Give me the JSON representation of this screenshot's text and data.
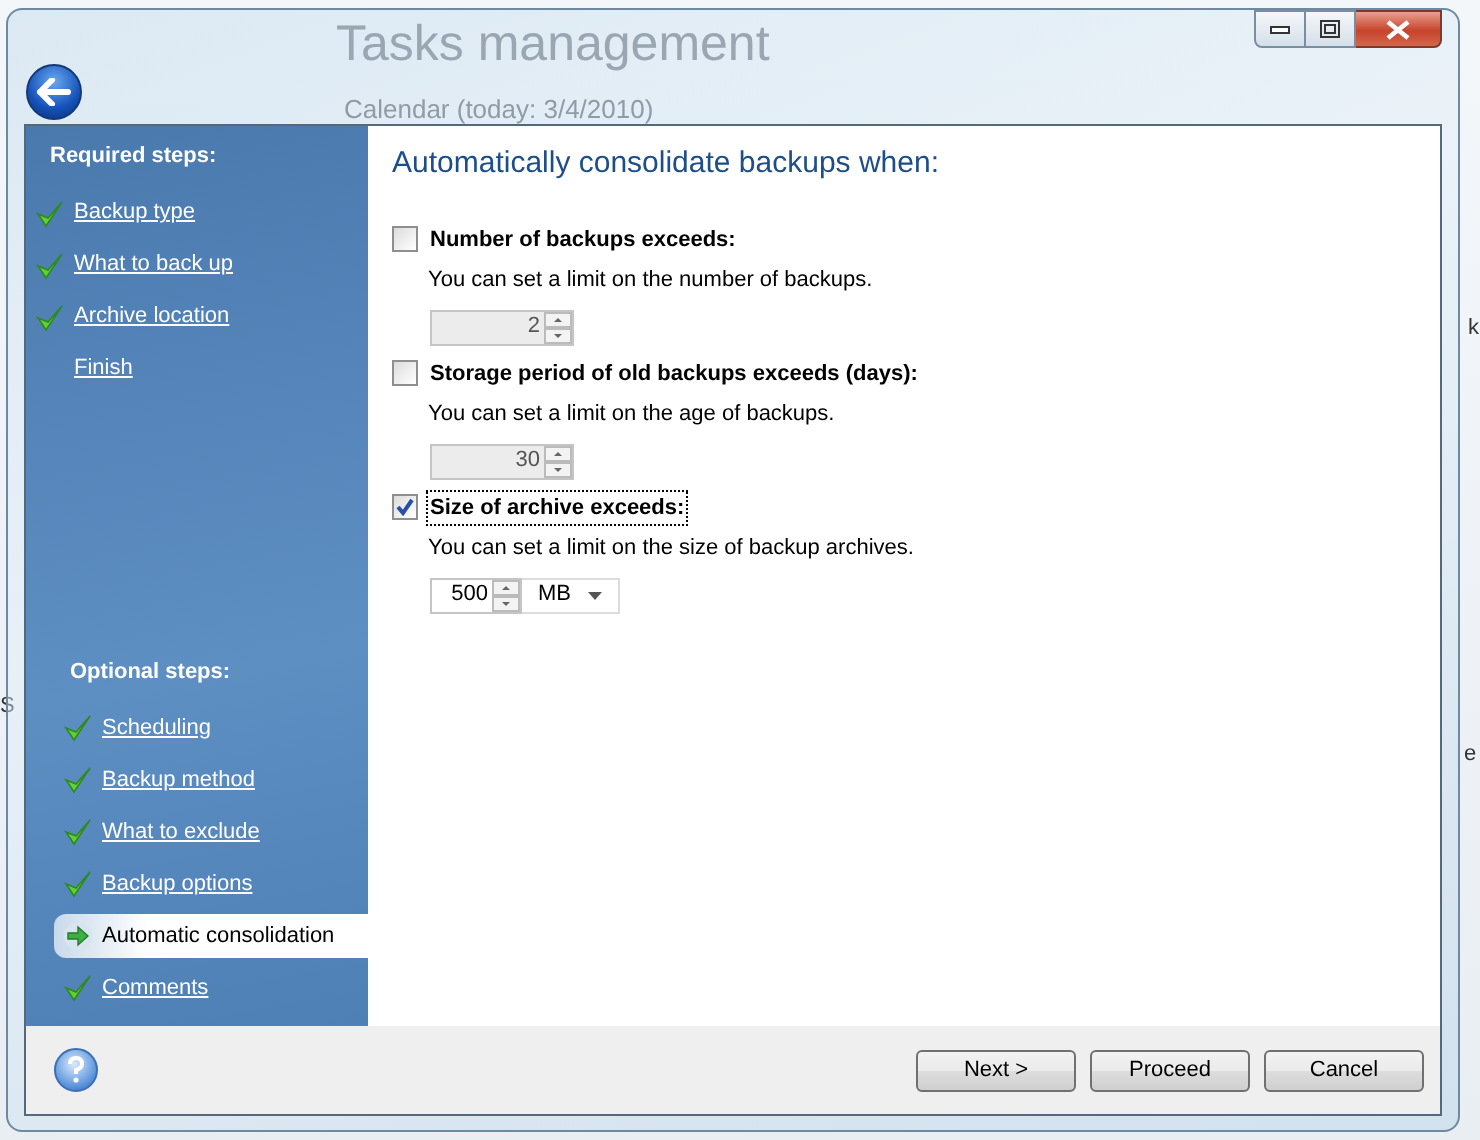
{
  "background_window": {
    "title": "Tasks management",
    "subtitle": "Calendar (today: 3/4/2010)",
    "edge_texts": [
      {
        "text": "k"
      },
      {
        "text": "S"
      },
      {
        "text": "e"
      }
    ]
  },
  "wizard": {
    "sidebar": {
      "groups": [
        {
          "heading": "Required steps:",
          "items": [
            {
              "label": "Backup type",
              "done": true,
              "selected": false
            },
            {
              "label": "What to back up",
              "done": true,
              "selected": false
            },
            {
              "label": "Archive location",
              "done": true,
              "selected": false
            },
            {
              "label": "Finish",
              "done": false,
              "selected": false
            }
          ]
        },
        {
          "heading": "Optional steps:",
          "items": [
            {
              "label": "Scheduling",
              "done": true,
              "selected": false
            },
            {
              "label": "Backup method",
              "done": true,
              "selected": false
            },
            {
              "label": "What to exclude",
              "done": true,
              "selected": false
            },
            {
              "label": "Backup options",
              "done": true,
              "selected": false
            },
            {
              "label": "Automatic consolidation",
              "done": false,
              "selected": true
            },
            {
              "label": "Comments",
              "done": true,
              "selected": false
            }
          ]
        }
      ]
    },
    "content": {
      "heading": "Automatically consolidate backups when:",
      "options": [
        {
          "label": "Number of backups exceeds:",
          "checked": false,
          "focused": false,
          "hint": "You can set a limit on the number of backups.",
          "value": "2"
        },
        {
          "label": "Storage period of old backups exceeds (days):",
          "checked": false,
          "focused": false,
          "hint": "You can set a limit on the age of backups.",
          "value": "30"
        },
        {
          "label": "Size of archive exceeds:",
          "checked": true,
          "focused": true,
          "hint": "You can set a limit on the size of backup archives.",
          "value": "500",
          "unit": "MB"
        }
      ]
    },
    "buttons": [
      {
        "label": "Next >"
      },
      {
        "label": "Proceed"
      },
      {
        "label": "Cancel"
      }
    ]
  }
}
